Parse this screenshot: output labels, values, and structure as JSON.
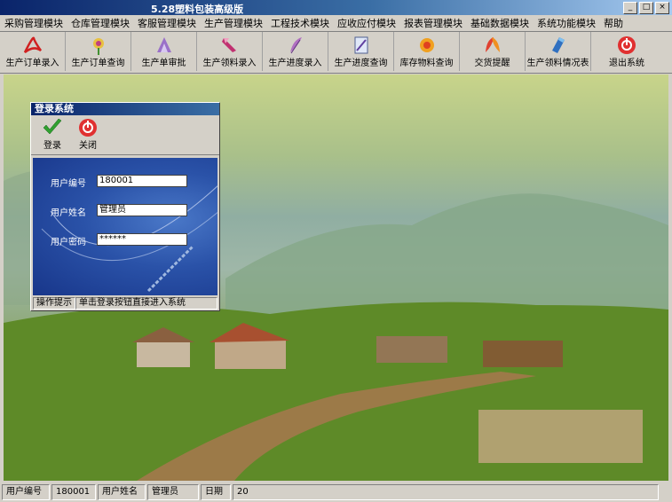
{
  "window": {
    "title": "5.28塑料包装高级版",
    "btn_min": "_",
    "btn_max": "□",
    "btn_close": "×"
  },
  "menu": [
    "采购管理模块",
    "仓库管理模块",
    "客服管理模块",
    "生产管理模块",
    "工程技术模块",
    "应收应付模块",
    "报表管理模块",
    "基础数据模块",
    "系统功能模块",
    "帮助"
  ],
  "toolbar": [
    {
      "label": "生产订单录入",
      "icon": "acrobat-icon"
    },
    {
      "label": "生产订单查询",
      "icon": "flower-icon"
    },
    {
      "label": "生产单审批",
      "icon": "stamp-icon"
    },
    {
      "label": "生产领料录入",
      "icon": "pen-icon"
    },
    {
      "label": "生产进度录入",
      "icon": "feather-icon"
    },
    {
      "label": "生产进度查询",
      "icon": "document-icon"
    },
    {
      "label": "库存物料查询",
      "icon": "gear-flower-icon"
    },
    {
      "label": "交货提醒",
      "icon": "leaf-icon"
    },
    {
      "label": "生产领料情况表",
      "icon": "brush-icon"
    },
    {
      "label": "退出系统",
      "icon": "power-icon"
    }
  ],
  "login": {
    "title": "登录系统",
    "login_btn": "登录",
    "close_btn": "关闭",
    "user_id_label": "用户编号",
    "user_id_value": "180001",
    "user_name_label": "用户姓名",
    "user_name_value": "管理员",
    "password_label": "用户密码",
    "password_value": "******",
    "hint_label": "操作提示",
    "hint_text": "单击登录按钮直接进入系统"
  },
  "status": {
    "user_id_label": "用户编号",
    "user_id_value": "180001",
    "user_name_label": "用户姓名",
    "user_name_value": "管理员",
    "date_label": "日期",
    "date_value": "20"
  },
  "colors": {
    "titlebar": "#0a246a",
    "accent_red": "#e03020",
    "panel_blue": "#2a52a8"
  }
}
